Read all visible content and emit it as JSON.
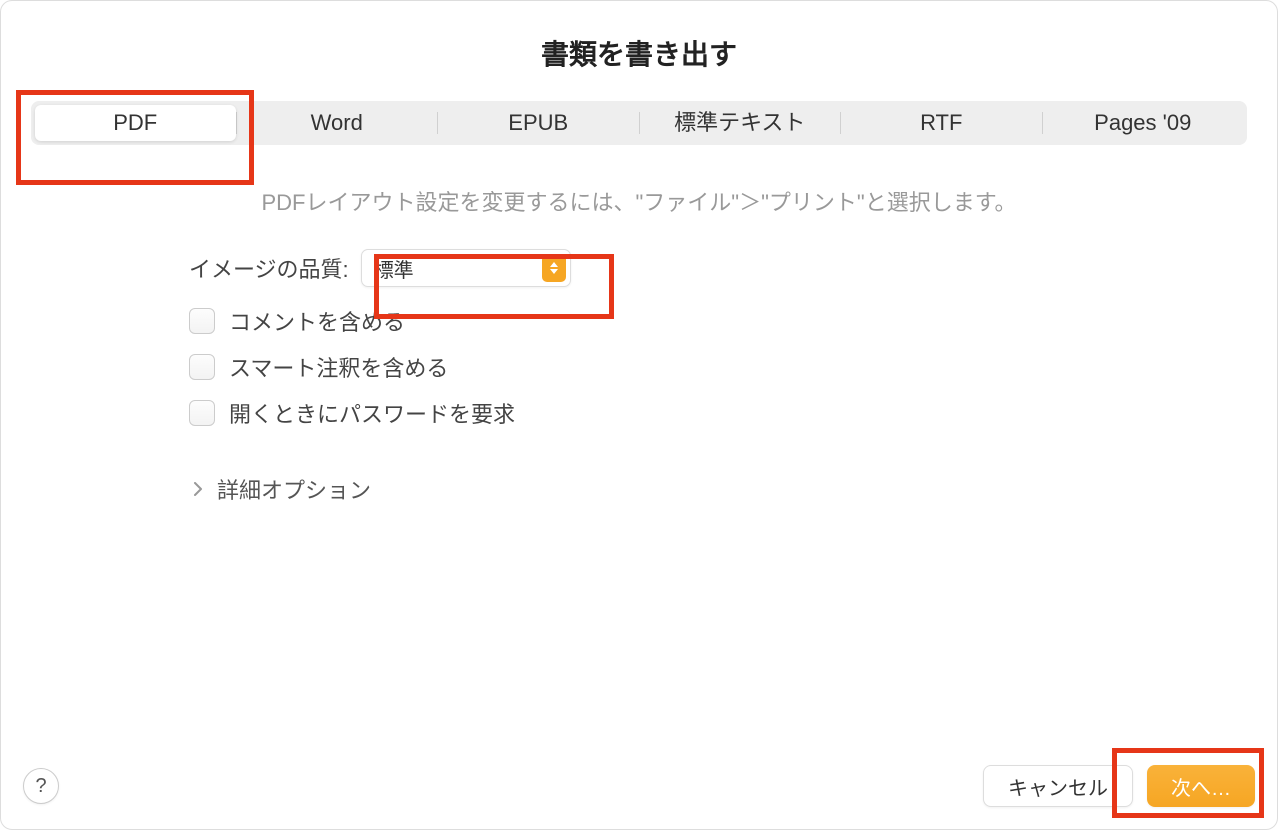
{
  "dialog": {
    "title": "書類を書き出す",
    "tabs": [
      {
        "label": "PDF",
        "active": true
      },
      {
        "label": "Word",
        "active": false
      },
      {
        "label": "EPUB",
        "active": false
      },
      {
        "label": "標準テキスト",
        "active": false
      },
      {
        "label": "RTF",
        "active": false
      },
      {
        "label": "Pages '09",
        "active": false
      }
    ],
    "help_text": "PDFレイアウト設定を変更するには、\"ファイル\"＞\"プリント\"と選択します。",
    "image_quality": {
      "label": "イメージの品質:",
      "value": "標準"
    },
    "checkboxes": [
      {
        "label": "コメントを含める",
        "checked": false
      },
      {
        "label": "スマート注釈を含める",
        "checked": false
      },
      {
        "label": "開くときにパスワードを要求",
        "checked": false
      }
    ],
    "advanced_label": "詳細オプション",
    "footer": {
      "help": "?",
      "cancel": "キャンセル",
      "next": "次へ…"
    }
  },
  "colors": {
    "accent": "#f6a623",
    "highlight": "#e63618"
  }
}
